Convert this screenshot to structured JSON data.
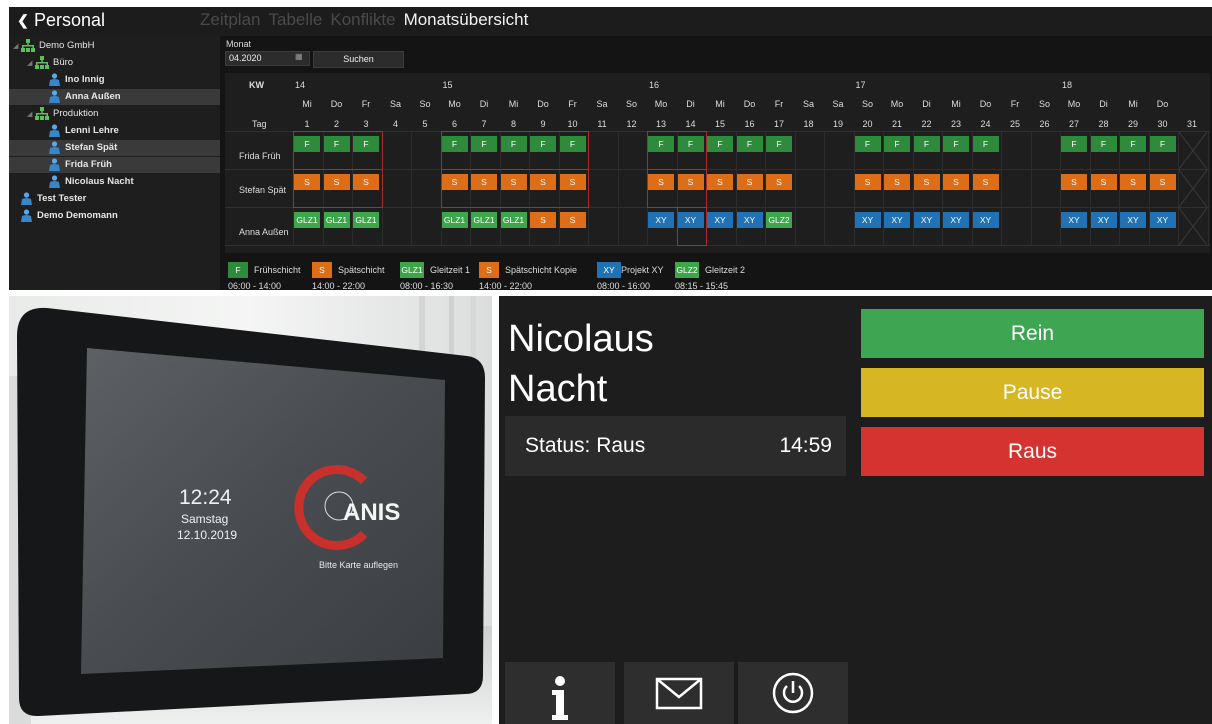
{
  "app": {
    "title": "Personal",
    "back_icon": "chevron-left-icon"
  },
  "tabs": [
    {
      "label": "Zeitplan",
      "active": false
    },
    {
      "label": "Tabelle",
      "active": false
    },
    {
      "label": "Konflikte",
      "active": false
    },
    {
      "label": "Monatsübersicht",
      "active": true
    }
  ],
  "tree": [
    {
      "label": "Demo GmbH",
      "type": "org",
      "level": 0,
      "selected": false
    },
    {
      "label": "Büro",
      "type": "org",
      "level": 1,
      "selected": false
    },
    {
      "label": "Ino Innig",
      "type": "user",
      "level": 2,
      "selected": false
    },
    {
      "label": "Anna Außen",
      "type": "user",
      "level": 2,
      "selected": true
    },
    {
      "label": "Produktion",
      "type": "org",
      "level": 1,
      "selected": false
    },
    {
      "label": "Lenni Lehre",
      "type": "user",
      "level": 2,
      "selected": false
    },
    {
      "label": "Stefan Spät",
      "type": "user",
      "level": 2,
      "selected": true
    },
    {
      "label": "Frida Früh",
      "type": "user",
      "level": 2,
      "selected": true
    },
    {
      "label": "Nicolaus Nacht",
      "type": "user",
      "level": 2,
      "selected": false
    },
    {
      "label": "Test Tester",
      "type": "user",
      "level": 0,
      "selected": false
    },
    {
      "label": "Demo Demomann",
      "type": "user",
      "level": 0,
      "selected": false
    }
  ],
  "month": {
    "label": "Monat",
    "value": "04.2020",
    "calendar_icon": "calendar-icon",
    "search_label": "Suchen"
  },
  "calendar": {
    "kw_label": "KW",
    "tag_label": "Tag",
    "weeks": [
      {
        "kw": "14",
        "day": 1
      },
      {
        "kw": "15",
        "day": 6
      },
      {
        "kw": "16",
        "day": 13
      },
      {
        "kw": "17",
        "day": 20
      },
      {
        "kw": "18",
        "day": 27
      }
    ],
    "days": [
      {
        "wd": "Mi",
        "d": "1"
      },
      {
        "wd": "Do",
        "d": "2"
      },
      {
        "wd": "Fr",
        "d": "3"
      },
      {
        "wd": "Sa",
        "d": "4"
      },
      {
        "wd": "So",
        "d": "5"
      },
      {
        "wd": "Mo",
        "d": "6"
      },
      {
        "wd": "Di",
        "d": "7"
      },
      {
        "wd": "Mi",
        "d": "8"
      },
      {
        "wd": "Do",
        "d": "9"
      },
      {
        "wd": "Fr",
        "d": "10"
      },
      {
        "wd": "Sa",
        "d": "11"
      },
      {
        "wd": "So",
        "d": "12"
      },
      {
        "wd": "Mo",
        "d": "13"
      },
      {
        "wd": "Di",
        "d": "14"
      },
      {
        "wd": "Mi",
        "d": "15"
      },
      {
        "wd": "Do",
        "d": "16"
      },
      {
        "wd": "Fr",
        "d": "17"
      },
      {
        "wd": "Sa",
        "d": "18"
      },
      {
        "wd": "Sa",
        "d": "19"
      },
      {
        "wd": "So",
        "d": "20"
      },
      {
        "wd": "Mo",
        "d": "21"
      },
      {
        "wd": "Di",
        "d": "22"
      },
      {
        "wd": "Mi",
        "d": "23"
      },
      {
        "wd": "Do",
        "d": "24"
      },
      {
        "wd": "Fr",
        "d": "25"
      },
      {
        "wd": "So",
        "d": "26"
      },
      {
        "wd": "Mo",
        "d": "27"
      },
      {
        "wd": "Di",
        "d": "28"
      },
      {
        "wd": "Mi",
        "d": "29"
      },
      {
        "wd": "Do",
        "d": "30"
      },
      {
        "wd": "",
        "d": "31"
      }
    ],
    "rows": [
      {
        "name": "Frida Früh",
        "cells": [
          "F",
          "F",
          "F",
          "",
          "",
          "F",
          "F",
          "F",
          "F",
          "F",
          "",
          "",
          "F",
          "F",
          "F",
          "F",
          "F",
          "",
          "",
          "F",
          "F",
          "F",
          "F",
          "F",
          "",
          "",
          "F",
          "F",
          "F",
          "F",
          "X"
        ]
      },
      {
        "name": "Stefan Spät",
        "cells": [
          "S",
          "S",
          "S",
          "",
          "",
          "S",
          "S",
          "S",
          "S",
          "S",
          "",
          "",
          "S",
          "S",
          "S",
          "S",
          "S",
          "",
          "",
          "S",
          "S",
          "S",
          "S",
          "S",
          "",
          "",
          "S",
          "S",
          "S",
          "S",
          "X"
        ]
      },
      {
        "name": "Anna Außen",
        "cells": [
          "GLZ1",
          "GLZ1",
          "GLZ1",
          "",
          "",
          "GLZ1",
          "GLZ1",
          "GLZ1",
          "S",
          "S",
          "",
          "",
          "XY",
          "XY",
          "XY",
          "XY",
          "GLZ2",
          "",
          "",
          "XY",
          "XY",
          "XY",
          "XY",
          "XY",
          "",
          "",
          "XY",
          "XY",
          "XY",
          "XY",
          "X"
        ]
      }
    ],
    "highlights": [
      {
        "from": 0,
        "to": 2,
        "rows": [
          0,
          1
        ]
      },
      {
        "from": 5,
        "to": 9,
        "rows": [
          0,
          1
        ]
      },
      {
        "from": 12,
        "to": 13,
        "rows": [
          0,
          1
        ]
      },
      {
        "from": 13,
        "to": 13,
        "rows": [
          2
        ]
      }
    ]
  },
  "shift_types": {
    "F": {
      "color": "#2e8b3c"
    },
    "S": {
      "color": "#dd6d16"
    },
    "GLZ1": {
      "color": "#3da64a"
    },
    "GLZ2": {
      "color": "#3da64a"
    },
    "XY": {
      "color": "#2171b5"
    }
  },
  "legend": [
    {
      "code": "F",
      "name": "Frühschicht",
      "time": "06:00 - 14:00",
      "color": "#2e8b3c"
    },
    {
      "code": "S",
      "name": "Spätschicht",
      "time": "14:00 - 22:00",
      "color": "#dd6d16"
    },
    {
      "code": "GLZ1",
      "name": "Gleitzeit 1",
      "time": "08:00 - 16:30",
      "color": "#3da64a"
    },
    {
      "code": "S",
      "name": "Spätschicht Kopie",
      "time": "14:00 - 22:00",
      "color": "#dd6d16"
    },
    {
      "code": "XY",
      "name": "Projekt XY",
      "time": "08:00 - 16:00",
      "color": "#2171b5"
    },
    {
      "code": "GLZ2",
      "name": "Gleitzeit 2",
      "time": "08:15 - 15:45",
      "color": "#3da64a"
    }
  ],
  "device": {
    "time": "12:24",
    "weekday": "Samstag",
    "date": "12.10.2019",
    "logo_text": "ANIS",
    "hint": "Bitte Karte auflegen"
  },
  "kiosk": {
    "name_line1": "Nicolaus",
    "name_line2": "Nacht",
    "status": "Status: Raus",
    "time": "14:59",
    "buttons": [
      {
        "label": "Rein",
        "color": "#3ea652"
      },
      {
        "label": "Pause",
        "color": "#d6b723"
      },
      {
        "label": "Raus",
        "color": "#d5332f"
      }
    ],
    "footer_icons": [
      "info-icon",
      "mail-icon",
      "power-icon"
    ]
  }
}
